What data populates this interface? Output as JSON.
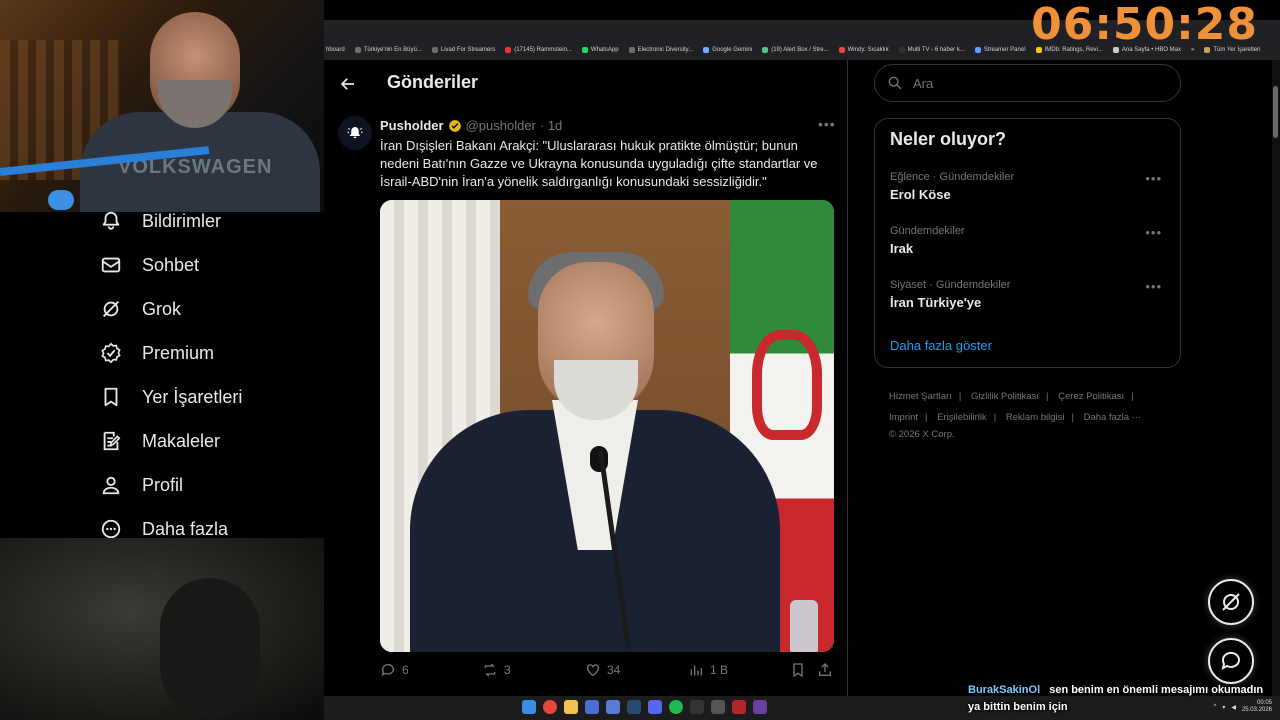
{
  "clock": "06:50:28",
  "bookmarks": [
    "hboard",
    "Türkiye'nin En Büyü...",
    "Livad For Streamers",
    "(17145) Rammstein...",
    "WhatsApp",
    "Electronic Diversity...",
    "Google Gemini",
    "(19) Alert Box / Stre...",
    "Windy: Sıcaklık",
    "Multi TV - 6 haber k...",
    "Streamer Panel",
    "IMDb: Ratings, Revi...",
    "Ana Sayfa • HBO Max",
    "»",
    "Tüm Yer İşaretleri"
  ],
  "nav": {
    "items": [
      {
        "label": "Bildirimler",
        "icon": "bell-icon"
      },
      {
        "label": "Sohbet",
        "icon": "mail-icon"
      },
      {
        "label": "Grok",
        "icon": "grok-icon"
      },
      {
        "label": "Premium",
        "icon": "premium-icon"
      },
      {
        "label": "Yer İşaretleri",
        "icon": "bookmark-icon"
      },
      {
        "label": "Makaleler",
        "icon": "article-icon"
      },
      {
        "label": "Profil",
        "icon": "person-icon"
      },
      {
        "label": "Daha fazla",
        "icon": "more-icon"
      }
    ]
  },
  "webcam": {
    "shirt_text": "VOLKSWAGEN"
  },
  "main": {
    "title": "Gönderiler",
    "post": {
      "author": "Pusholder",
      "handle": "@pusholder",
      "time": "· 1d",
      "text": "İran Dışişleri Bakanı Arakçi: \"Uluslararası hukuk pratikte ölmüştür; bunun nedeni Batı'nın Gazze ve Ukrayna konusunda uyguladığı çifte standartlar ve İsrail-ABD'nin İran'a yönelik saldırganlığı konusundaki sessizliğidir.\"",
      "replies": "6",
      "reposts": "3",
      "likes": "34",
      "views": "1 B"
    }
  },
  "search": {
    "placeholder": "Ara"
  },
  "trends": {
    "title": "Neler oluyor?",
    "items": [
      {
        "category": "Eğlence · Gündemdekiler",
        "name": "Erol Köse"
      },
      {
        "category": "Gündemdekiler",
        "name": "Irak"
      },
      {
        "category": "Siyaset · Gündemdekiler",
        "name": "İran Türkiye'ye"
      }
    ],
    "show_more": "Daha fazla göster"
  },
  "footer": {
    "links": [
      "Hizmet Şartları",
      "Gizlilik Politikası",
      "Çerez Politikası",
      "Imprint",
      "Erişilebilirlik",
      "Reklam bilgisi",
      "Daha fazla ···"
    ],
    "copyright": "© 2026 X Corp."
  },
  "chat": {
    "user": "BurakSakinOl",
    "message": "sen benim en önemli mesajımı okumadın ya bittin benim için"
  },
  "taskbar": {
    "time": "00:05",
    "date": "25.03.2026"
  },
  "colors": {
    "accent": "#1d9bf0",
    "clock": "#f0913a",
    "muted": "#71767b",
    "border": "#2f3336"
  }
}
